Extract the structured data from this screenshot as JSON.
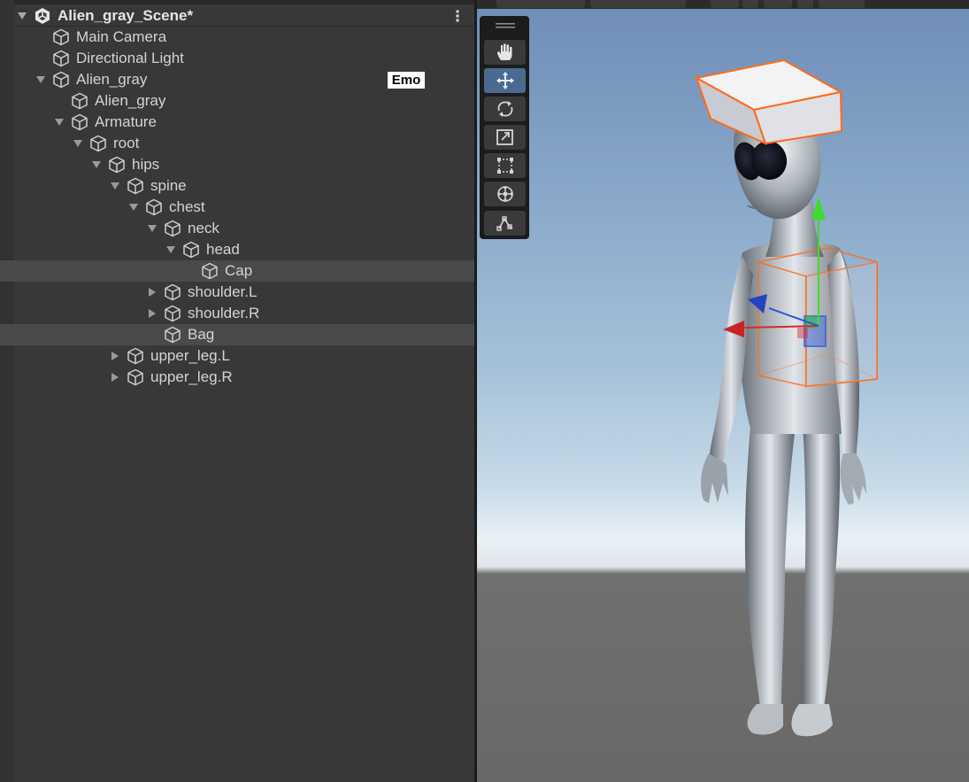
{
  "hierarchy": {
    "scene_name": "Alien_gray_Scene*",
    "items": [
      {
        "label": "Main Camera"
      },
      {
        "label": "Directional Light"
      },
      {
        "label": "Alien_gray"
      },
      {
        "label": "Alien_gray"
      },
      {
        "label": "Armature"
      },
      {
        "label": "root"
      },
      {
        "label": "hips"
      },
      {
        "label": "spine"
      },
      {
        "label": "chest"
      },
      {
        "label": "neck"
      },
      {
        "label": "head"
      },
      {
        "label": "Cap"
      },
      {
        "label": "shoulder.L"
      },
      {
        "label": "shoulder.R"
      },
      {
        "label": "Bag"
      },
      {
        "label": "upper_leg.L"
      },
      {
        "label": "upper_leg.R"
      }
    ],
    "badge": "Emo"
  },
  "scene_tools": [
    {
      "name": "hand-tool",
      "icon": "hand-icon"
    },
    {
      "name": "move-tool",
      "icon": "move-arrows-icon",
      "active": true
    },
    {
      "name": "rotate-tool",
      "icon": "rotate-icon"
    },
    {
      "name": "scale-tool",
      "icon": "scale-icon"
    },
    {
      "name": "rect-tool",
      "icon": "rect-icon"
    },
    {
      "name": "transform-tool",
      "icon": "transform-icon"
    },
    {
      "name": "custom-tool",
      "icon": "custom-tool-icon"
    }
  ],
  "colors": {
    "panel_bg": "#383838",
    "selection": "#4a4a4a",
    "active_tool": "#4a6a92",
    "selection_outline": "#ff6a1a",
    "axis_x": "#d82a2a",
    "axis_y": "#3fdc2a",
    "axis_z": "#2a5ad8"
  }
}
